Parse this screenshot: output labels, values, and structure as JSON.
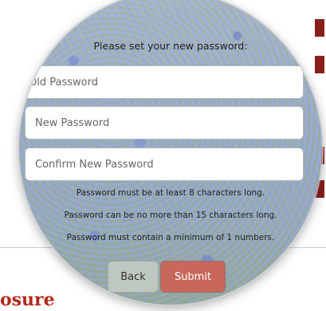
{
  "background": {
    "heading_fragment": "osure"
  },
  "form": {
    "prompt": "Please set your new password:",
    "old_password_placeholder": "Old Password",
    "new_password_placeholder": "New Password",
    "confirm_password_placeholder": "Confirm New Password",
    "rules": [
      "Password must be at least 8 characters long.",
      "Password can be no more than 15 characters long.",
      "Password must contain a minimum of 1 numbers."
    ],
    "back_label": "Back",
    "submit_label": "Submit"
  },
  "colors": {
    "heading_red": "#b22a1c",
    "submit_button": "#c9685a",
    "accent_strip": "#8a1f1a"
  }
}
